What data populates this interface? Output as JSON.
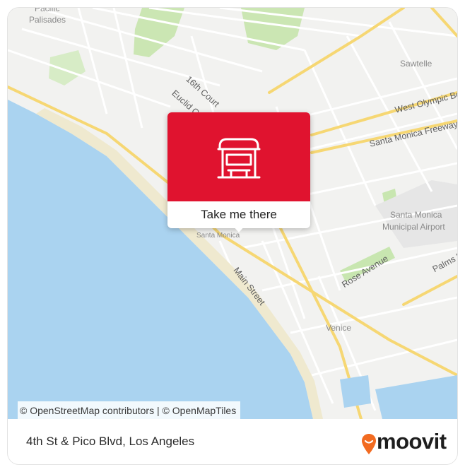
{
  "map": {
    "labels": {
      "pacific_palisades_1": "Pacific",
      "pacific_palisades_2": "Palisades",
      "sawtelle": "Sawtelle",
      "west_olympic": "West Olympic Bou",
      "sm_freeway": "Santa Monica Freeway",
      "sixteenth_court": "16th Court",
      "euclid": "Euclid Co",
      "santa_monica": "Santa Monica",
      "santa_monica_small": "Santa Monica",
      "sm_airport_1": "Santa Monica",
      "sm_airport_2": "Municipal Airport",
      "rose_avenue": "Rose Avenue",
      "palms": "Palms Bo",
      "main_street": "Main Street",
      "venice": "Venice"
    },
    "attribution": "© OpenStreetMap contributors | © OpenMapTiles",
    "colors": {
      "water": "#aad3f0",
      "land": "#f2f2f0",
      "beach": "#efe9cf",
      "park": "#c8e6b0",
      "major_road": "#f6d773",
      "minor_road": "#ffffff"
    }
  },
  "popup": {
    "icon": "bus-stop-icon",
    "cta_label": "Take me there",
    "accent": "#e0132f"
  },
  "footer": {
    "address": "4th St & Pico Blvd, Los Angeles",
    "brand": "moovit",
    "brand_pin_color": "#f26b21"
  }
}
